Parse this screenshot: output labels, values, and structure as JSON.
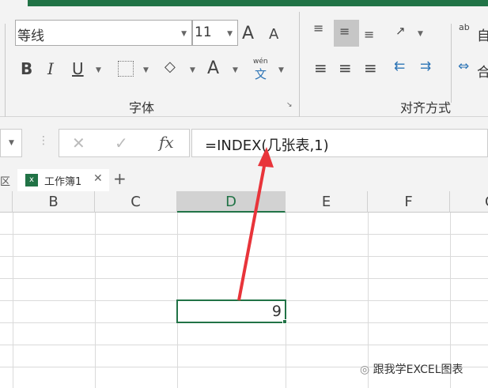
{
  "ribbon": {
    "font_name": "等线",
    "font_size": "11",
    "grow_font": "A",
    "shrink_font": "A",
    "bold": "B",
    "italic": "I",
    "underline": "U",
    "font_color": "A",
    "phonetic_top": "wén",
    "phonetic_bottom": "文",
    "font_group": "字体",
    "align_group": "对齐方式",
    "wrap_text": "自",
    "merge": "合",
    "wrap_icon_text": "ab"
  },
  "formula_bar": {
    "formula": "=INDEX(几张表,1)",
    "cancel": "✕",
    "enter": "✓",
    "fx": "fx"
  },
  "tabs": {
    "prev": "区",
    "workbook": "工作簿1",
    "close": "✕",
    "add": "+"
  },
  "columns": [
    "B",
    "C",
    "D",
    "E",
    "F",
    "G"
  ],
  "cell": {
    "value": "9"
  },
  "watermark": "跟我学EXCEL图表",
  "colors": {
    "accent": "#217346",
    "arrow": "#e8343a"
  }
}
